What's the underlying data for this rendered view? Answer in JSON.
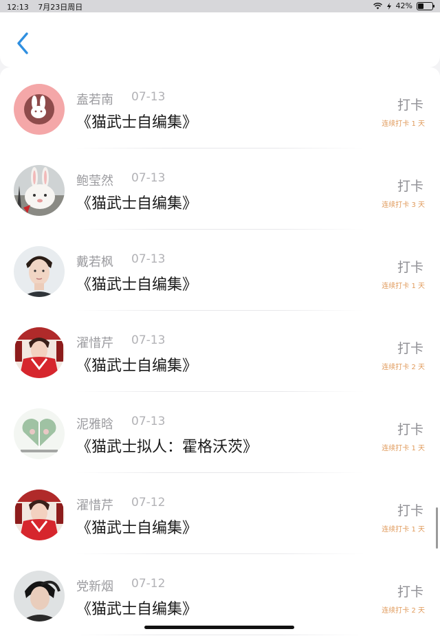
{
  "status_bar": {
    "time": "12:13",
    "date": "7月23日周日",
    "battery": "42%",
    "battery_level": 0.42
  },
  "nav": {
    "back_icon": "chevron-left-icon",
    "accent_color": "#2f8fe0"
  },
  "entries": [
    {
      "name": "盍若南",
      "date": "07-13",
      "title": "《猫武士自编集》",
      "action": "打卡",
      "streak": "连续打卡 1 天",
      "avatar": "pink-rabbit-logo"
    },
    {
      "name": "鲍莹然",
      "date": "07-13",
      "title": "《猫武士自编集》",
      "action": "打卡",
      "streak": "连续打卡 3 天",
      "avatar": "plush-bunny"
    },
    {
      "name": "戴若枫",
      "date": "07-13",
      "title": "《猫武士自编集》",
      "action": "打卡",
      "streak": "连续打卡 1 天",
      "avatar": "young-man-portrait"
    },
    {
      "name": "濯惜芹",
      "date": "07-13",
      "title": "《猫武士自编集》",
      "action": "打卡",
      "streak": "连续打卡 2 天",
      "avatar": "red-outfit-portrait"
    },
    {
      "name": "泥雅晗",
      "date": "07-13",
      "title": "《猫武士拟人：霍格沃茨》",
      "action": "打卡",
      "streak": "连续打卡 1 天",
      "avatar": "heart-collage"
    },
    {
      "name": "濯惜芹",
      "date": "07-12",
      "title": "《猫武士自编集》",
      "action": "打卡",
      "streak": "连续打卡 1 天",
      "avatar": "red-outfit-portrait"
    },
    {
      "name": "党新烟",
      "date": "07-12",
      "title": "《猫武士自编集》",
      "action": "打卡",
      "streak": "连续打卡 2 天",
      "avatar": "dark-hair-portrait"
    }
  ],
  "colors": {
    "streak": "#e09a5b",
    "name": "#9b9b9f",
    "title": "#1b1b1b"
  }
}
